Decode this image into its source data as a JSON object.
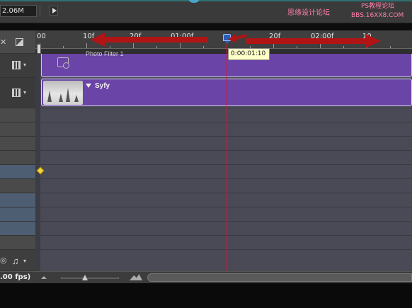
{
  "toolbar": {
    "size_value": "2.06M"
  },
  "watermark": {
    "line1": "思缘设计论坛",
    "line2": "PS教程论坛",
    "line3": "BBS.16XX8.COM"
  },
  "ruler": {
    "labels": [
      "00",
      "10f",
      "20f",
      "01:00f",
      "20f",
      "02:00f",
      "10"
    ]
  },
  "playhead": {
    "timecode": "0:00:01:10"
  },
  "tracks": {
    "clip1_label": "Photo Filter 1",
    "clip2_label": "Syfy"
  },
  "bottom": {
    "fps_label": ".00 fps)"
  },
  "colors": {
    "clip_purple": "#6a44a6",
    "playhead_red": "#c81e3c",
    "keyframe_yellow": "#f2d43c",
    "annotation_arrow": "#b01414"
  },
  "icons": [
    "play-icon",
    "close-icon",
    "clip-icon",
    "film-icon",
    "chevron-down-icon",
    "photo-filter-icon",
    "music-icon",
    "speaker-icon",
    "keyframe-icon",
    "zoom-out-icon",
    "zoom-in-icon"
  ]
}
